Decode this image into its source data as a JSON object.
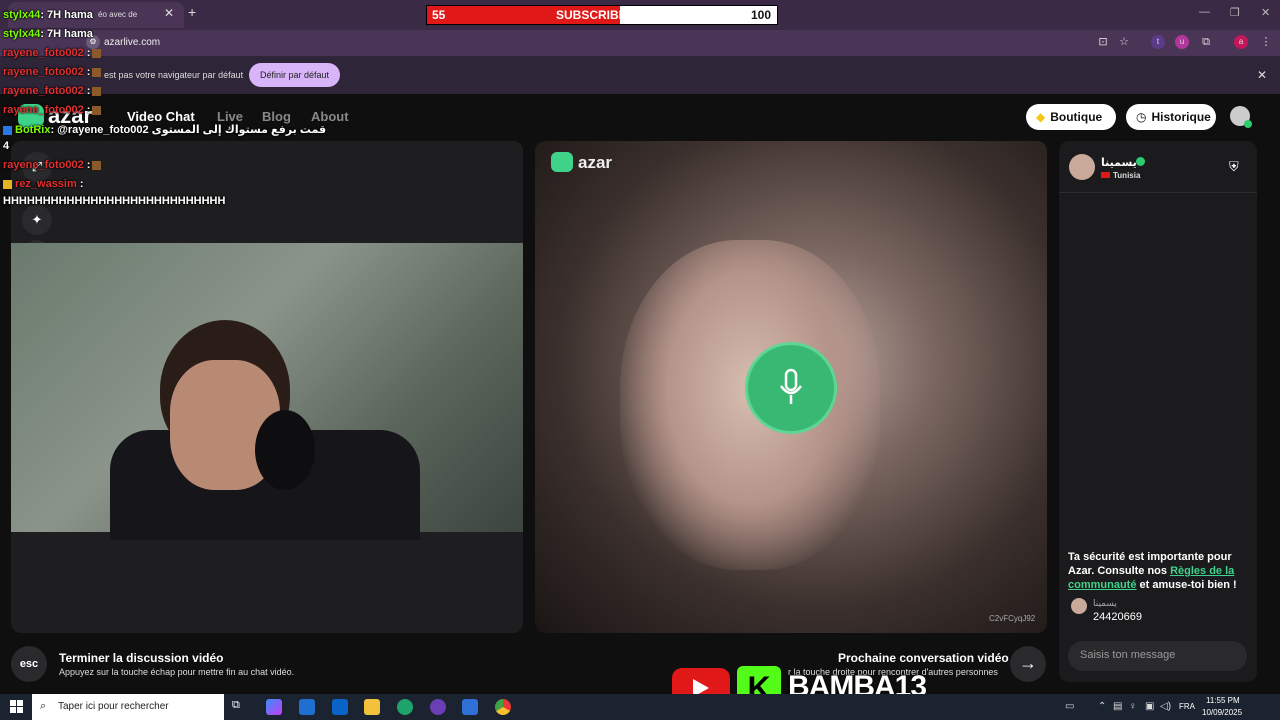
{
  "browser": {
    "tab_text": "éo avec de",
    "url": "azarlive.com",
    "infobar_text": "est pas votre navigateur par défaut",
    "default_button": "Définir par défaut",
    "close": "✕",
    "new_tab": "+"
  },
  "subscribers": {
    "current": "55",
    "label": "SUBSCRIBERS",
    "goal": "100",
    "progress": 0.55
  },
  "azar": {
    "logo": "azar",
    "nav": [
      "Video Chat",
      "Live",
      "Blog",
      "About"
    ],
    "boutique": "Boutique",
    "historique": "Historique",
    "video_id": "C2vFCyqJ92"
  },
  "partner": {
    "name": "يسمينا",
    "country": "Tunisia"
  },
  "chat": {
    "safety_a": "Ta sécurité est importante pour Azar. Consulte nos ",
    "safety_link": "Règles de la communauté",
    "safety_b": " et amuse-toi bien !",
    "msg_name": "يسمينا",
    "msg_text": "24420669",
    "input_placeholder": "Saisis ton message"
  },
  "bottom": {
    "esc": "esc",
    "end_title": "Terminer la discussion vidéo",
    "end_sub": "Appuyez sur la touche échap pour mettre fin au chat vidéo.",
    "next_title": "Prochaine conversation vidéo",
    "next_sub": "r la touche droite pour rencontrer d'autres personnes",
    "next_arrow": "→"
  },
  "stream_chat": [
    {
      "user": "stylx44",
      "msg": ": 7H hama",
      "color": "green"
    },
    {
      "user": "stylx44",
      "msg": ": 7H hama",
      "color": "green"
    },
    {
      "user": "rayene_foto002",
      "msg": " :",
      "color": "red"
    },
    {
      "user": "rayene_foto002",
      "msg": " :",
      "color": "red"
    },
    {
      "user": "rayene_foto002",
      "msg": " :",
      "color": "red"
    },
    {
      "user": "rayene_foto002",
      "msg": " :",
      "color": "red"
    },
    {
      "user": "BotRix",
      "msg": ": @rayene_foto002 قمت برفع مستواك إلى المستوى",
      "color": "green"
    },
    {
      "user": "",
      "msg": "4",
      "color": "white"
    },
    {
      "user": "rayene_foto002",
      "msg": " :",
      "color": "red"
    },
    {
      "user": "rez_wassim",
      "msg": " :",
      "color": "red"
    },
    {
      "user": "",
      "msg": "HHHHHHHHHHHHHHHHHHHHHHHHHHHH",
      "color": "white"
    }
  ],
  "branding": {
    "k": "K",
    "name": "BAMBA13"
  },
  "taskbar": {
    "search_placeholder": "Taper ici pour rechercher",
    "lang": "FRA",
    "time": "11:55 PM",
    "date": "10/09/2025"
  },
  "colors": {
    "accent_green": "#3fd38a",
    "sub_red": "#e11818",
    "kick_green": "#53fc18"
  }
}
